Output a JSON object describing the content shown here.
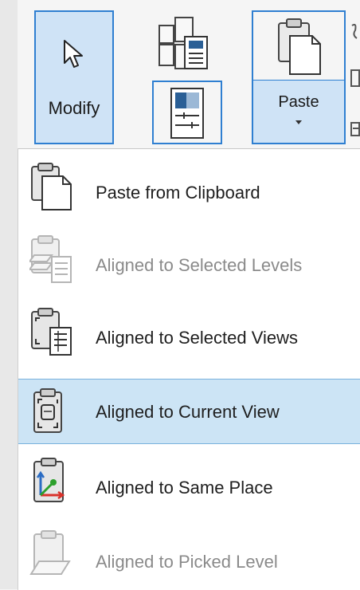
{
  "ribbon": {
    "modify_label": "Modify",
    "paste_label": "Paste",
    "accent_color": "#2f7fd1",
    "highlight_color": "#cfe3f6"
  },
  "paste_menu": {
    "items": [
      {
        "label": "Paste from Clipboard",
        "icon": "paste-clipboard-icon",
        "enabled": true,
        "highlighted": false
      },
      {
        "label": "Aligned to Selected Levels",
        "icon": "aligned-selected-levels-icon",
        "enabled": false,
        "highlighted": false
      },
      {
        "label": "Aligned to Selected Views",
        "icon": "aligned-selected-views-icon",
        "enabled": true,
        "highlighted": false
      },
      {
        "label": "Aligned to Current View",
        "icon": "aligned-current-view-icon",
        "enabled": true,
        "highlighted": true
      },
      {
        "label": "Aligned to Same Place",
        "icon": "aligned-same-place-icon",
        "enabled": true,
        "highlighted": false
      },
      {
        "label": "Aligned to Picked Level",
        "icon": "aligned-picked-level-icon",
        "enabled": false,
        "highlighted": false
      }
    ]
  }
}
